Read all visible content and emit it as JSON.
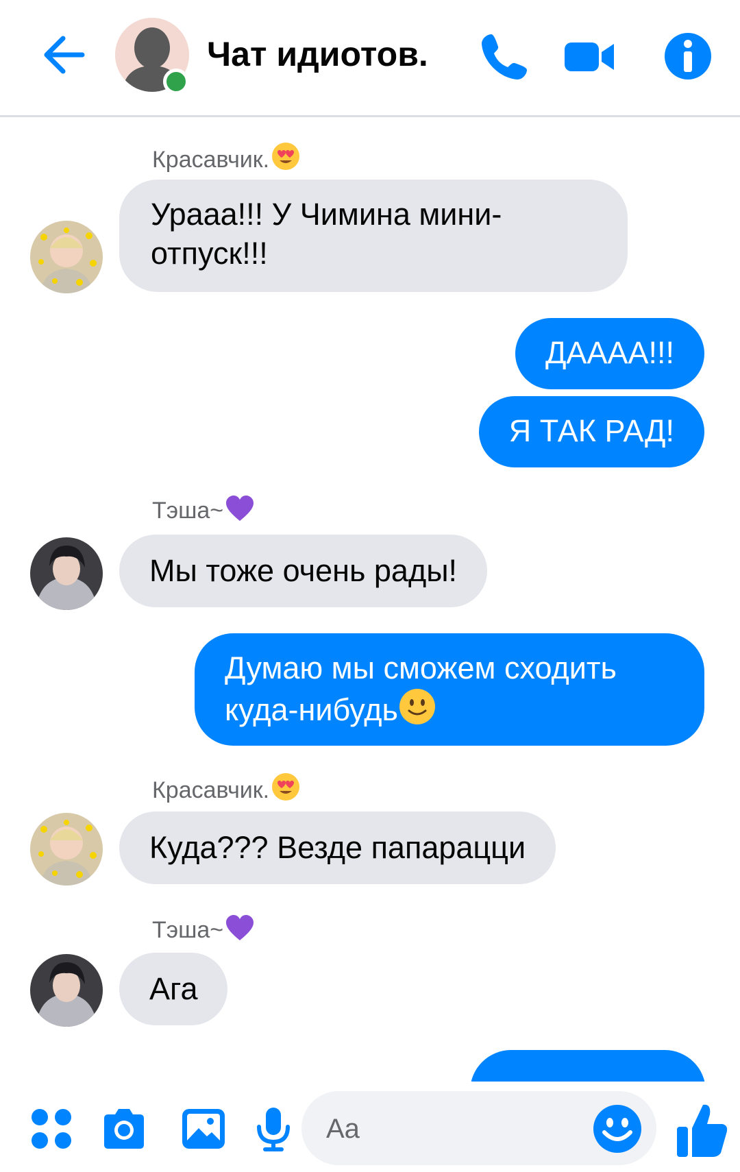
{
  "header": {
    "chat_title": "Чат идиотов.",
    "online": true,
    "icons": [
      "back-arrow-icon",
      "phone-icon",
      "video-camera-icon",
      "info-icon"
    ]
  },
  "messages": [
    {
      "sender": "Красавчик.",
      "sender_emoji": "heart-eyes-emoji",
      "direction": "in",
      "text_lines": [
        "Урааа!!! У Чимина мини-",
        "отпуск!!!"
      ]
    },
    {
      "direction": "out",
      "text": "ДАААА!!!"
    },
    {
      "direction": "out",
      "text": "Я ТАК РАД!"
    },
    {
      "sender": "Тэша~",
      "sender_emoji": "purple-heart-emoji",
      "direction": "in",
      "text": "Мы тоже очень рады!"
    },
    {
      "direction": "out",
      "text_lines": [
        "Думаю мы сможем сходить",
        "куда-нибудь"
      ],
      "trailing_emoji": "smiling-face-emoji"
    },
    {
      "sender": "Красавчик.",
      "sender_emoji": "heart-eyes-emoji",
      "direction": "in",
      "text": "Куда??? Везде папарацци"
    },
    {
      "sender": "Тэша~",
      "sender_emoji": "purple-heart-emoji",
      "direction": "in",
      "text": "Ага"
    }
  ],
  "composer": {
    "placeholder": "Aa",
    "icons": [
      "apps-grid-icon",
      "camera-icon",
      "gallery-icon",
      "microphone-icon",
      "emoji-icon",
      "thumbs-up-icon"
    ]
  },
  "colors": {
    "accent": "#0084ff",
    "incoming_bubble": "#e4e6eb",
    "online": "#31a24c"
  }
}
